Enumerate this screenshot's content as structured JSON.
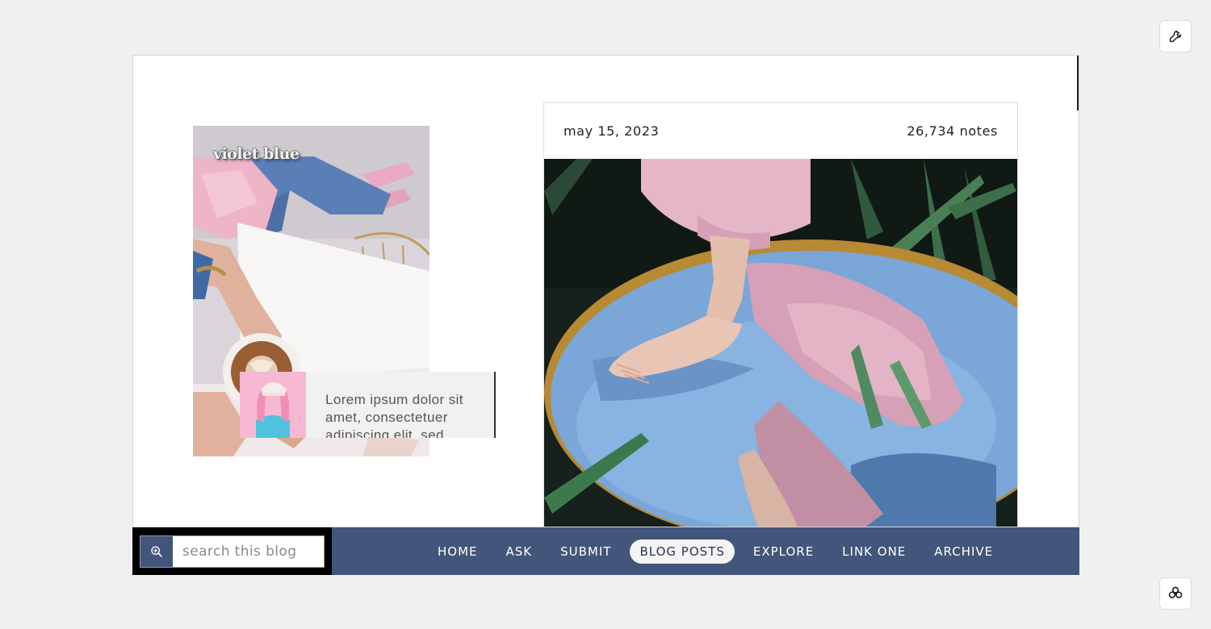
{
  "blog": {
    "title": "violet blue",
    "about_text": "Lorem ipsum dolor sit amet, consectetuer adipiscing elit, sed"
  },
  "post": {
    "date": "may 15, 2023",
    "notes": "26,734 notes"
  },
  "search": {
    "placeholder": "search this blog"
  },
  "nav": {
    "items": [
      {
        "label": "HOME",
        "active": false
      },
      {
        "label": "ASK",
        "active": false
      },
      {
        "label": "SUBMIT",
        "active": false
      },
      {
        "label": "BLOG POSTS",
        "active": true
      },
      {
        "label": "EXPLORE",
        "active": false
      },
      {
        "label": "LINK ONE",
        "active": false
      },
      {
        "label": "ARCHIVE",
        "active": false
      }
    ]
  },
  "icons": {
    "tools": "wrench-icon",
    "bottom": "flower-icon",
    "search": "zoom-in-icon"
  },
  "colors": {
    "nav_bar": "#42557a",
    "page_bg": "#f0f0f0",
    "active_pill": "#f4f4f4"
  }
}
